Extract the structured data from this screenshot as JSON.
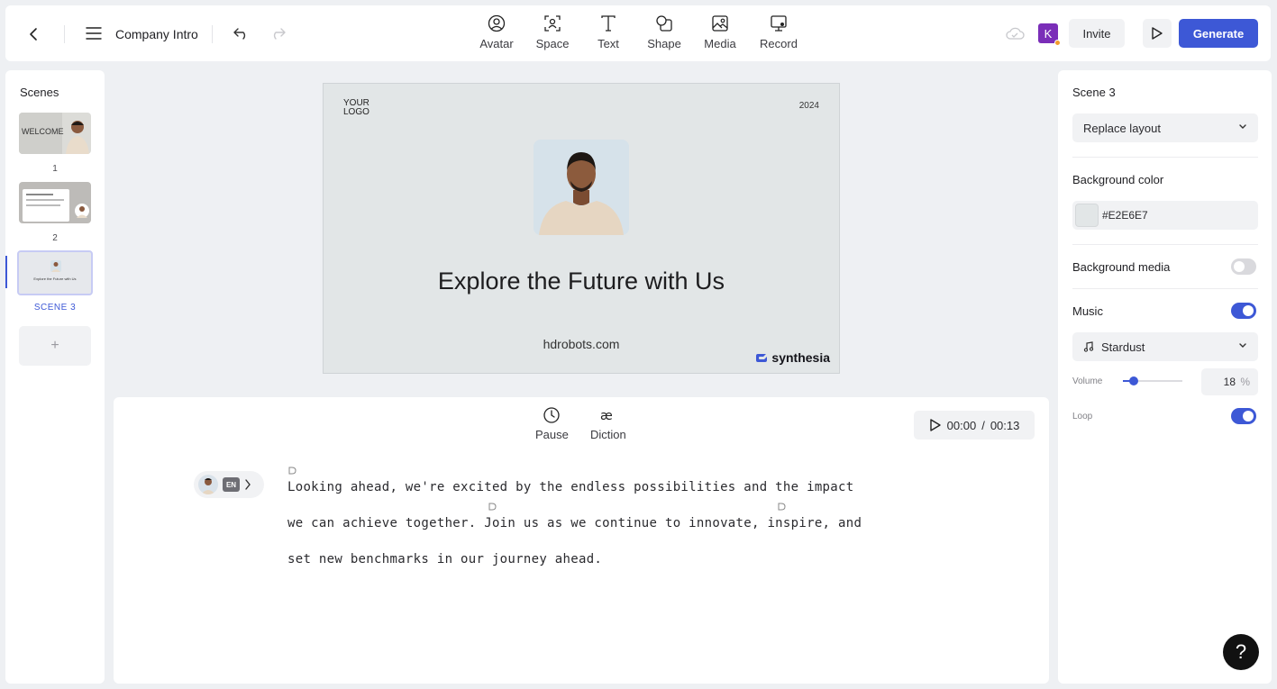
{
  "header": {
    "title": "Company Intro",
    "tools": [
      {
        "label": "Avatar",
        "icon": "avatar-icon"
      },
      {
        "label": "Space",
        "icon": "space-icon"
      },
      {
        "label": "Text",
        "icon": "text-icon"
      },
      {
        "label": "Shape",
        "icon": "shape-icon"
      },
      {
        "label": "Media",
        "icon": "media-icon"
      },
      {
        "label": "Record",
        "icon": "record-icon"
      }
    ],
    "user_initial": "K",
    "invite_label": "Invite",
    "generate_label": "Generate"
  },
  "scenes": {
    "title": "Scenes",
    "items": [
      {
        "number": "1",
        "thumb_text": "WELCOME"
      },
      {
        "number": "2"
      },
      {
        "label": "SCENE 3",
        "thumb_text": "Explore the Future with Us"
      }
    ],
    "add_label": "+"
  },
  "canvas": {
    "logo": "YOUR\nLOGO",
    "year": "2024",
    "headline": "Explore the Future with Us",
    "website": "hdrobots.com",
    "brand": "synthesia",
    "background": "#E2E6E7"
  },
  "script": {
    "pause_label": "Pause",
    "diction_label": "Diction",
    "time_current": "00:00",
    "time_total": "00:13",
    "language": "EN",
    "lines": [
      "Looking ahead, we're excited by the endless possibilities and the impact",
      "we can achieve together. Join us as we continue to innovate, inspire, and",
      "set new benchmarks in our journey ahead."
    ]
  },
  "properties": {
    "scene_title": "Scene 3",
    "layout_label": "Replace layout",
    "bg_color_label": "Background color",
    "bg_color_value": "#E2E6E7",
    "bg_media_label": "Background media",
    "bg_media_on": false,
    "music_label": "Music",
    "music_on": true,
    "track": "Stardust",
    "volume_label": "Volume",
    "volume_value": "18",
    "volume_unit": "%",
    "loop_label": "Loop",
    "loop_on": true
  },
  "help_label": "?",
  "colors": {
    "accent": "#3D58D6",
    "avatar_k": "#7A2EB8",
    "panel": "#FFFFFF",
    "background": "#EEF0F3"
  }
}
